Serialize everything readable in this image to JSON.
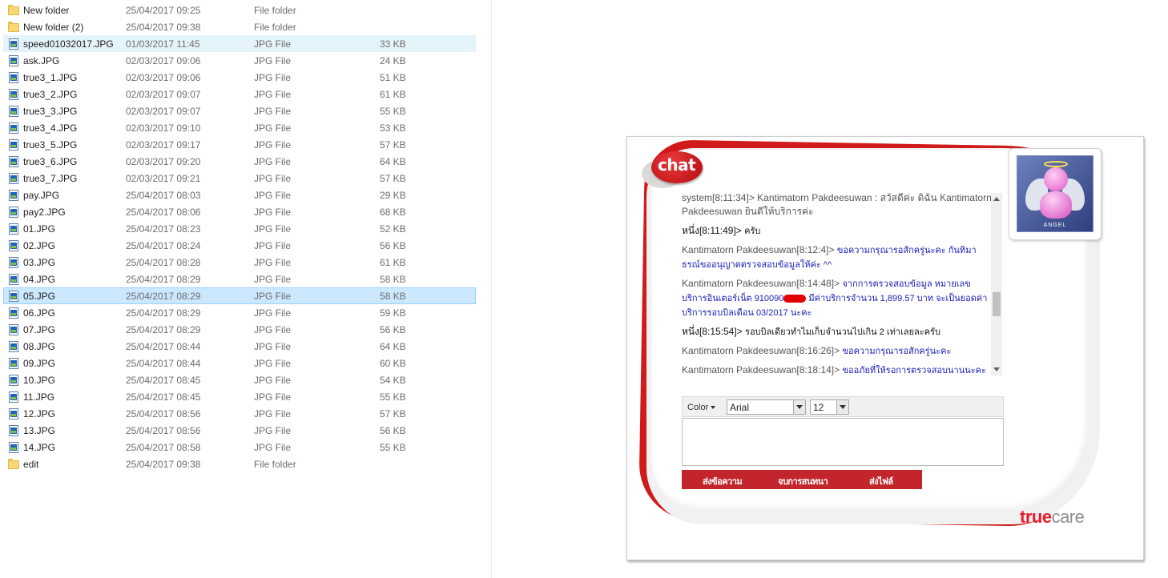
{
  "files": [
    {
      "name": "New folder",
      "date": "25/04/2017 09:25",
      "type": "File folder",
      "size": "",
      "icon": "folder-icon",
      "state": ""
    },
    {
      "name": "New folder (2)",
      "date": "25/04/2017 09:38",
      "type": "File folder",
      "size": "",
      "icon": "folder-icon",
      "state": ""
    },
    {
      "name": "speed01032017.JPG",
      "date": "01/03/2017 11:45",
      "type": "JPG File",
      "size": "33 KB",
      "icon": "jpg-icon",
      "state": "hover"
    },
    {
      "name": "ask.JPG",
      "date": "02/03/2017 09:06",
      "type": "JPG File",
      "size": "24 KB",
      "icon": "jpg-icon",
      "state": ""
    },
    {
      "name": "true3_1.JPG",
      "date": "02/03/2017 09:06",
      "type": "JPG File",
      "size": "51 KB",
      "icon": "jpg-icon",
      "state": ""
    },
    {
      "name": "true3_2.JPG",
      "date": "02/03/2017 09:07",
      "type": "JPG File",
      "size": "61 KB",
      "icon": "jpg-icon",
      "state": ""
    },
    {
      "name": "true3_3.JPG",
      "date": "02/03/2017 09:07",
      "type": "JPG File",
      "size": "55 KB",
      "icon": "jpg-icon",
      "state": ""
    },
    {
      "name": "true3_4.JPG",
      "date": "02/03/2017 09:10",
      "type": "JPG File",
      "size": "53 KB",
      "icon": "jpg-icon",
      "state": ""
    },
    {
      "name": "true3_5.JPG",
      "date": "02/03/2017 09:17",
      "type": "JPG File",
      "size": "57 KB",
      "icon": "jpg-icon",
      "state": ""
    },
    {
      "name": "true3_6.JPG",
      "date": "02/03/2017 09:20",
      "type": "JPG File",
      "size": "64 KB",
      "icon": "jpg-icon",
      "state": ""
    },
    {
      "name": "true3_7.JPG",
      "date": "02/03/2017 09:21",
      "type": "JPG File",
      "size": "57 KB",
      "icon": "jpg-icon",
      "state": ""
    },
    {
      "name": "pay.JPG",
      "date": "25/04/2017 08:03",
      "type": "JPG File",
      "size": "29 KB",
      "icon": "jpg-icon",
      "state": ""
    },
    {
      "name": "pay2.JPG",
      "date": "25/04/2017 08:06",
      "type": "JPG File",
      "size": "68 KB",
      "icon": "jpg-icon",
      "state": ""
    },
    {
      "name": "01.JPG",
      "date": "25/04/2017 08:23",
      "type": "JPG File",
      "size": "52 KB",
      "icon": "jpg-icon",
      "state": ""
    },
    {
      "name": "02.JPG",
      "date": "25/04/2017 08:24",
      "type": "JPG File",
      "size": "56 KB",
      "icon": "jpg-icon",
      "state": ""
    },
    {
      "name": "03.JPG",
      "date": "25/04/2017 08:28",
      "type": "JPG File",
      "size": "61 KB",
      "icon": "jpg-icon",
      "state": ""
    },
    {
      "name": "04.JPG",
      "date": "25/04/2017 08:29",
      "type": "JPG File",
      "size": "58 KB",
      "icon": "jpg-icon",
      "state": ""
    },
    {
      "name": "05.JPG",
      "date": "25/04/2017 08:29",
      "type": "JPG File",
      "size": "58 KB",
      "icon": "jpg-icon",
      "state": "selected"
    },
    {
      "name": "06.JPG",
      "date": "25/04/2017 08:29",
      "type": "JPG File",
      "size": "59 KB",
      "icon": "jpg-icon",
      "state": ""
    },
    {
      "name": "07.JPG",
      "date": "25/04/2017 08:29",
      "type": "JPG File",
      "size": "56 KB",
      "icon": "jpg-icon",
      "state": ""
    },
    {
      "name": "08.JPG",
      "date": "25/04/2017 08:44",
      "type": "JPG File",
      "size": "64 KB",
      "icon": "jpg-icon",
      "state": ""
    },
    {
      "name": "09.JPG",
      "date": "25/04/2017 08:44",
      "type": "JPG File",
      "size": "60 KB",
      "icon": "jpg-icon",
      "state": ""
    },
    {
      "name": "10.JPG",
      "date": "25/04/2017 08:45",
      "type": "JPG File",
      "size": "54 KB",
      "icon": "jpg-icon",
      "state": ""
    },
    {
      "name": "11.JPG",
      "date": "25/04/2017 08:45",
      "type": "JPG File",
      "size": "55 KB",
      "icon": "jpg-icon",
      "state": ""
    },
    {
      "name": "12.JPG",
      "date": "25/04/2017 08:56",
      "type": "JPG File",
      "size": "57 KB",
      "icon": "jpg-icon",
      "state": ""
    },
    {
      "name": "13.JPG",
      "date": "25/04/2017 08:56",
      "type": "JPG File",
      "size": "56 KB",
      "icon": "jpg-icon",
      "state": ""
    },
    {
      "name": "14.JPG",
      "date": "25/04/2017 08:58",
      "type": "JPG File",
      "size": "55 KB",
      "icon": "jpg-icon",
      "state": ""
    },
    {
      "name": "edit",
      "date": "25/04/2017 09:38",
      "type": "File folder",
      "size": "",
      "icon": "folder-icon",
      "state": ""
    }
  ],
  "chat": {
    "logo_text": "chat",
    "avatar_label": "ANGEL",
    "messages": [
      {
        "from": "system[8:11:34]> Kantimatorn Pakdeesuwan : สวัสดีค่ะ ดิฉัน Kantimatorn Pakdeesuwan ยินดีให้บริการค่ะ",
        "text": "",
        "sender": "agent",
        "text_color": "black"
      },
      {
        "from": "หนึ่ง[8:11:49]>",
        "text": "ครับ",
        "sender": "customer",
        "text_color": "black"
      },
      {
        "from": "Kantimatorn Pakdeesuwan[8:12:4]>",
        "text": "ขอความกรุณารอสักครู่นะคะ กันทิมาธรณ์ขออนุญาตตรวจสอบข้อมูลให้ค่ะ ^^",
        "sender": "agent",
        "text_color": "blue"
      },
      {
        "from": "Kantimatorn Pakdeesuwan[8:14:48]>",
        "text_before": "จากการตรวจสอบข้อมูล หมายเลขบริการอินเตอร์เน็ต 910090",
        "text_after": " มีค่าบริการจำนวน 1,899.57 บาท จะเป็นยอดค่าบริการรอบบิลเดือน 03/2017 นะคะ",
        "sender": "agent",
        "text_color": "blue",
        "redacted": true
      },
      {
        "from": "หนึ่ง[8:15:54]>",
        "text": "รอบบิลเดียวทำไมเก็บจำนวนไปเกิน 2 เท่าเลยละครับ",
        "sender": "customer",
        "text_color": "black"
      },
      {
        "from": "Kantimatorn Pakdeesuwan[8:16:26]>",
        "text": "ขอความกรุณารอสักครู่นะคะ",
        "sender": "agent",
        "text_color": "blue"
      },
      {
        "from": "Kantimatorn Pakdeesuwan[8:18:14]>",
        "text": "ขออภัยที่ให้รอการตรวจสอบนานนะคะ",
        "sender": "agent",
        "text_color": "blue"
      }
    ],
    "toolbar": {
      "color_label": "Color",
      "font_value": "Arial",
      "size_value": "12"
    },
    "input_value": "",
    "actions": {
      "send": "ส่งข้อความ",
      "end_chat": "จบการสนทนา",
      "send_file": "ส่งไฟล์"
    },
    "brand": {
      "part1": "true",
      "part2": "care"
    }
  }
}
